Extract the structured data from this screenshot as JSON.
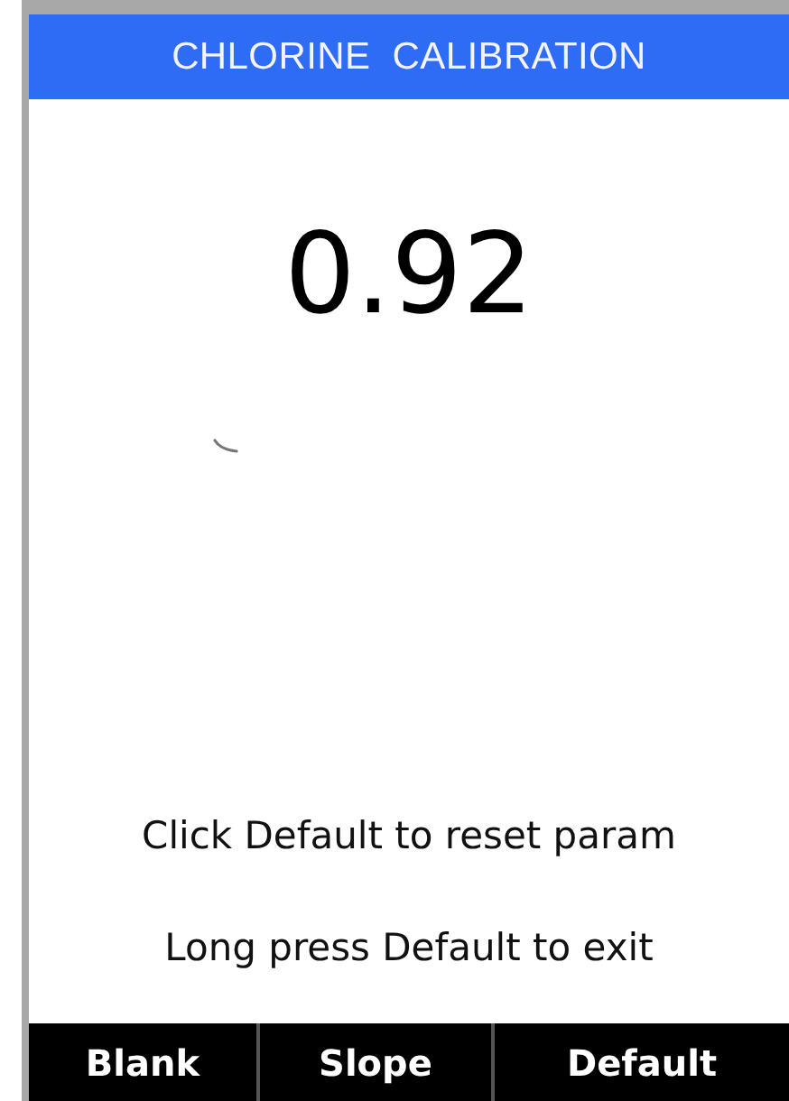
{
  "header": {
    "title": "CHLORINE  CALIBRATION"
  },
  "reading": {
    "value": "0.92"
  },
  "messages": [
    "Click Default to reset param",
    "Long press Default to exit"
  ],
  "softkeys": [
    {
      "label": "Blank"
    },
    {
      "label": "Slope"
    },
    {
      "label": "Default"
    }
  ]
}
